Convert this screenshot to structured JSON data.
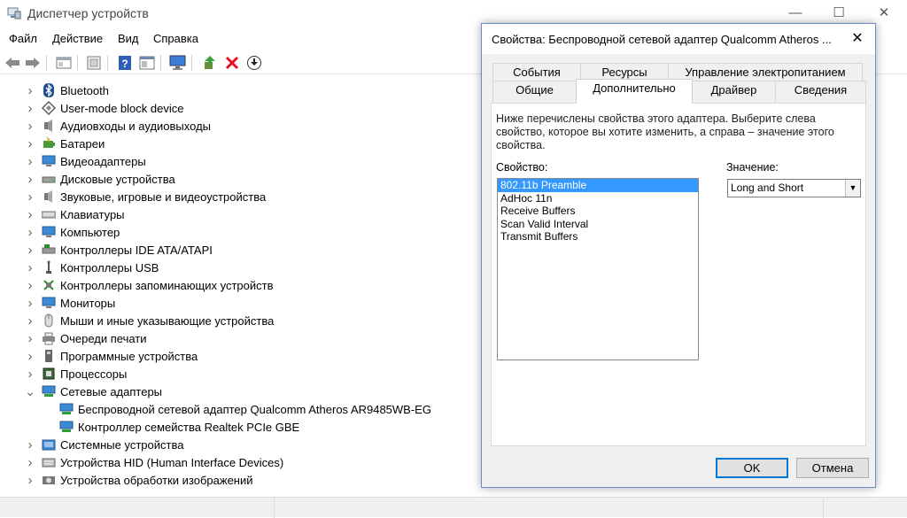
{
  "window": {
    "title": "Диспетчер устройств",
    "minimize_label": "—",
    "maximize_label": "☐",
    "close_label": "✕"
  },
  "menubar": {
    "items": [
      "Файл",
      "Действие",
      "Вид",
      "Справка"
    ]
  },
  "toolbar": {
    "buttons": [
      "back-arrow-icon",
      "forward-arrow-icon",
      "properties-icon",
      "help-book-icon",
      "help-icon",
      "view-icon",
      "monitor-scan-icon",
      "update-driver-icon",
      "uninstall-icon",
      "disable-icon"
    ]
  },
  "tree": {
    "items": [
      {
        "label": "Bluetooth",
        "icon": "bluetooth-icon",
        "expanded": false,
        "depth": 0
      },
      {
        "label": "User-mode block device",
        "icon": "block-device-icon",
        "expanded": false,
        "depth": 0
      },
      {
        "label": "Аудиовходы и аудиовыходы",
        "icon": "speaker-icon",
        "expanded": false,
        "depth": 0
      },
      {
        "label": "Батареи",
        "icon": "battery-icon",
        "expanded": false,
        "depth": 0
      },
      {
        "label": "Видеоадаптеры",
        "icon": "display-adapter-icon",
        "expanded": false,
        "depth": 0
      },
      {
        "label": "Дисковые устройства",
        "icon": "disk-drive-icon",
        "expanded": false,
        "depth": 0
      },
      {
        "label": "Звуковые, игровые и видеоустройства",
        "icon": "sound-icon",
        "expanded": false,
        "depth": 0
      },
      {
        "label": "Клавиатуры",
        "icon": "keyboard-icon",
        "expanded": false,
        "depth": 0
      },
      {
        "label": "Компьютер",
        "icon": "computer-icon",
        "expanded": false,
        "depth": 0
      },
      {
        "label": "Контроллеры IDE ATA/ATAPI",
        "icon": "ide-controller-icon",
        "expanded": false,
        "depth": 0
      },
      {
        "label": "Контроллеры USB",
        "icon": "usb-icon",
        "expanded": false,
        "depth": 0
      },
      {
        "label": "Контроллеры запоминающих устройств",
        "icon": "storage-controller-icon",
        "expanded": false,
        "depth": 0
      },
      {
        "label": "Мониторы",
        "icon": "monitor-icon",
        "expanded": false,
        "depth": 0
      },
      {
        "label": "Мыши и иные указывающие устройства",
        "icon": "mouse-icon",
        "expanded": false,
        "depth": 0
      },
      {
        "label": "Очереди печати",
        "icon": "printer-icon",
        "expanded": false,
        "depth": 0
      },
      {
        "label": "Программные устройства",
        "icon": "software-device-icon",
        "expanded": false,
        "depth": 0
      },
      {
        "label": "Процессоры",
        "icon": "processor-icon",
        "expanded": false,
        "depth": 0
      },
      {
        "label": "Сетевые адаптеры",
        "icon": "network-adapter-icon",
        "expanded": true,
        "depth": 0
      },
      {
        "label": "Беспроводной сетевой адаптер Qualcomm Atheros AR9485WB-EG",
        "icon": "network-adapter-icon",
        "expanded": null,
        "depth": 1
      },
      {
        "label": "Контроллер семейства Realtek PCIe GBE",
        "icon": "network-adapter-icon",
        "expanded": null,
        "depth": 1
      },
      {
        "label": "Системные устройства",
        "icon": "system-device-icon",
        "expanded": false,
        "depth": 0
      },
      {
        "label": "Устройства HID (Human Interface Devices)",
        "icon": "hid-icon",
        "expanded": false,
        "depth": 0
      },
      {
        "label": "Устройства обработки изображений",
        "icon": "camera-icon",
        "expanded": false,
        "depth": 0
      }
    ]
  },
  "dialog": {
    "title": "Свойства: Беспроводной сетевой адаптер Qualcomm Atheros ...",
    "close_label": "✕",
    "tabs_row1": [
      "События",
      "Ресурсы",
      "Управление электропитанием"
    ],
    "tabs_row2": [
      "Общие",
      "Дополнительно",
      "Драйвер",
      "Сведения"
    ],
    "active_tab": "Дополнительно",
    "description": "Ниже перечислены свойства этого адаптера. Выберите слева свойство, которое вы хотите изменить, а справа – значение этого свойства.",
    "property_label": "Свойство:",
    "value_label": "Значение:",
    "properties": [
      "802.11b Preamble",
      "AdHoc 11n",
      "Receive Buffers",
      "Scan Valid Interval",
      "Transmit Buffers"
    ],
    "selected_property": "802.11b Preamble",
    "value": "Long and Short",
    "ok_label": "OK",
    "cancel_label": "Отмена"
  },
  "colors": {
    "selection": "#3399ff",
    "dialog_border": "#6b8cc4",
    "default_button_border": "#0078d7",
    "uninstall_red": "#e81123"
  }
}
